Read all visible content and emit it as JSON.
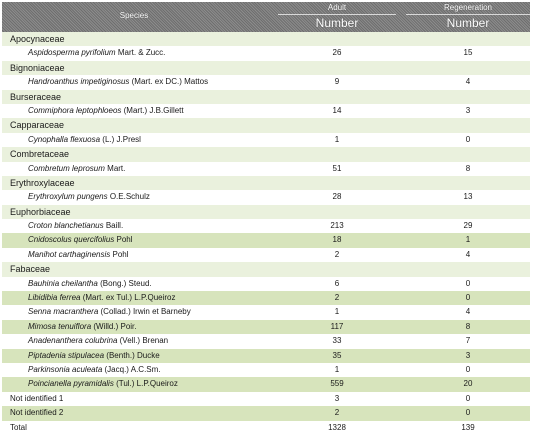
{
  "header": {
    "species": "Species",
    "adult": "Adult",
    "regeneration": "Regeneration",
    "adult_unit": "Number",
    "regeneration_unit": "Number"
  },
  "rows": [
    {
      "type": "family",
      "name": "Apocynaceae"
    },
    {
      "type": "species",
      "name": "Aspidosperma pyrifolium",
      "author": "Mart. & Zucc.",
      "adult": "26",
      "regen": "15"
    },
    {
      "type": "family",
      "name": "Bignoniaceae"
    },
    {
      "type": "species",
      "name": "Handroanthus impetiginosus",
      "author": "(Mart. ex DC.) Mattos",
      "adult": "9",
      "regen": "4"
    },
    {
      "type": "family",
      "name": "Burseraceae"
    },
    {
      "type": "species",
      "name": "Commiphora leptophloeos",
      "author": "(Mart.) J.B.Gillett",
      "adult": "14",
      "regen": "3"
    },
    {
      "type": "family",
      "name": "Capparaceae"
    },
    {
      "type": "species",
      "name": "Cynophalla flexuosa",
      "author": "(L.) J.Presl",
      "adult": "1",
      "regen": "0"
    },
    {
      "type": "family",
      "name": "Combretaceae"
    },
    {
      "type": "species",
      "name": "Combretum leprosum",
      "author": "Mart.",
      "adult": "51",
      "regen": "8"
    },
    {
      "type": "family",
      "name": "Erythroxylaceae"
    },
    {
      "type": "species",
      "name": "Erythroxylum pungens",
      "author": "O.E.Schulz",
      "adult": "28",
      "regen": "13"
    },
    {
      "type": "family",
      "name": "Euphorbiaceae"
    },
    {
      "type": "species",
      "name": "Croton blanchetianus",
      "author": "Baill.",
      "adult": "213",
      "regen": "29"
    },
    {
      "type": "species",
      "name": "Cnidoscolus quercifolius",
      "author": "Pohl",
      "adult": "18",
      "regen": "1",
      "highlight": true
    },
    {
      "type": "species",
      "name": "Manihot carthaginensis",
      "author": "Pohl",
      "adult": "2",
      "regen": "4"
    },
    {
      "type": "family",
      "name": "Fabaceae"
    },
    {
      "type": "species",
      "name": "Bauhinia cheilantha",
      "author": "(Bong.) Steud.",
      "adult": "6",
      "regen": "0"
    },
    {
      "type": "species",
      "name": "Libidibia ferrea",
      "author": "(Mart. ex Tul.) L.P.Queiroz",
      "adult": "2",
      "regen": "0",
      "highlight": true
    },
    {
      "type": "species",
      "name": "Senna macranthera",
      "author": "(Collad.) Irwin et Barneby",
      "adult": "1",
      "regen": "4"
    },
    {
      "type": "species",
      "name": "Mimosa tenuiflora",
      "author": "(Willd.) Poir.",
      "adult": "117",
      "regen": "8",
      "highlight": true
    },
    {
      "type": "species",
      "name": "Anadenanthera colubrina",
      "author": "(Vell.) Brenan",
      "adult": "33",
      "regen": "7"
    },
    {
      "type": "species",
      "name": "Piptadenia stipulacea",
      "author": "(Benth.) Ducke",
      "adult": "35",
      "regen": "3",
      "highlight": true
    },
    {
      "type": "species",
      "name": "Parkinsonia aculeata",
      "author": "(Jacq.) A.C.Sm.",
      "adult": "1",
      "regen": "0"
    },
    {
      "type": "species",
      "name": "Poincianella pyramidalis",
      "author": "(Tul.) L.P.Queiroz",
      "adult": "559",
      "regen": "20",
      "highlight": true
    },
    {
      "type": "top",
      "name": "Not identified 1",
      "adult": "3",
      "regen": "0"
    },
    {
      "type": "top",
      "name": "Not identified 2",
      "adult": "2",
      "regen": "0",
      "highlight": true
    },
    {
      "type": "top",
      "name": "Total",
      "adult": "1328",
      "regen": "139"
    }
  ]
}
